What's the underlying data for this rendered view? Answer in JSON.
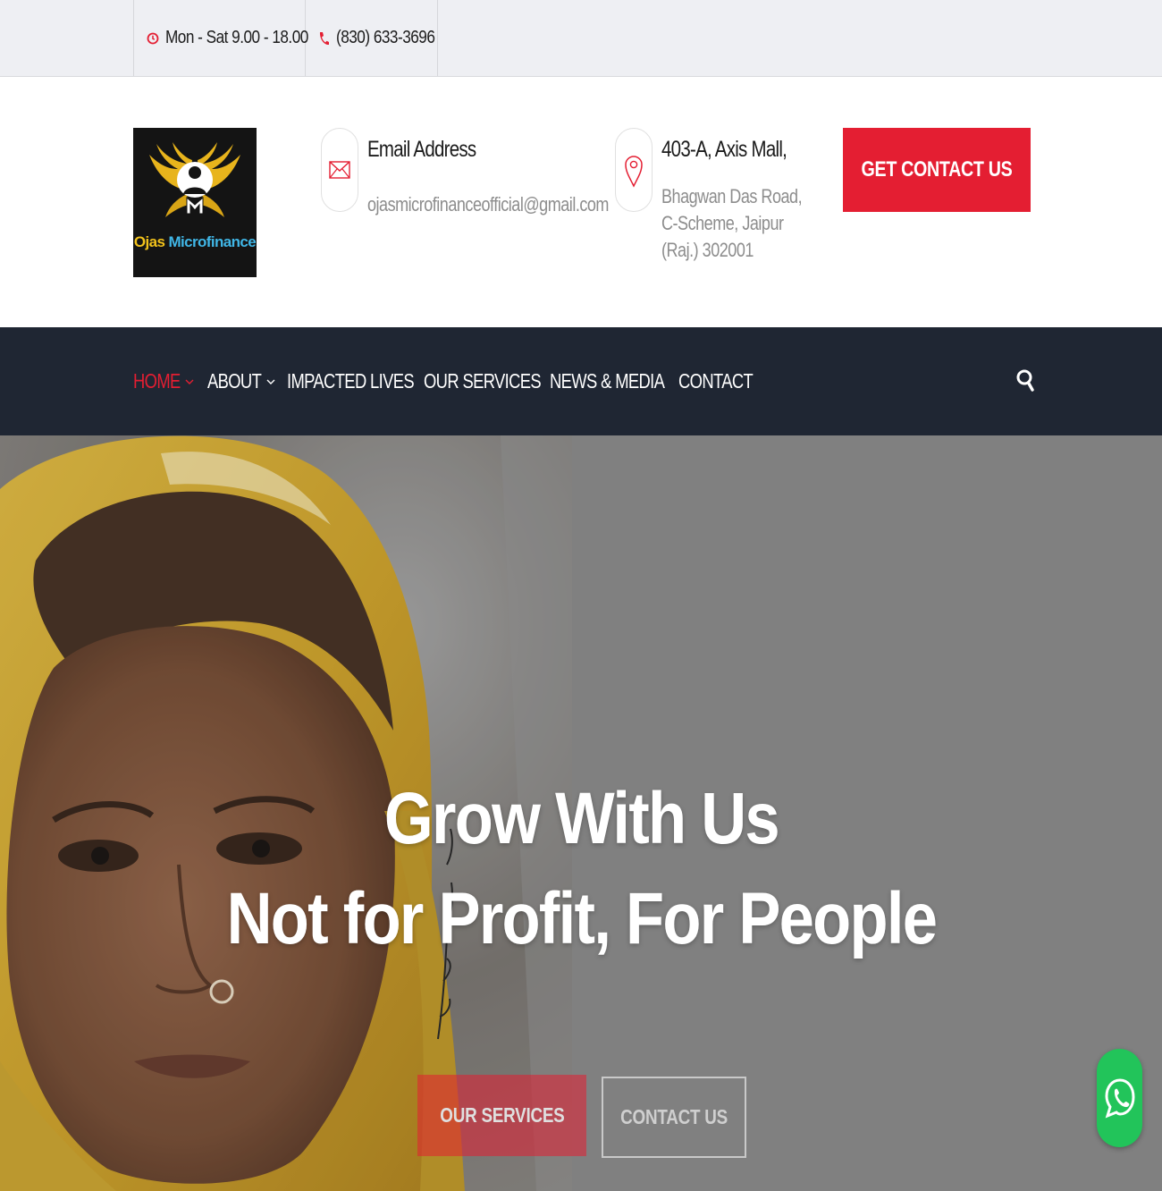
{
  "topbar": {
    "hours": "Mon - Sat 9.00 - 18.00",
    "phone": "(830) 633-3696"
  },
  "logo": {
    "word1": "Ojas",
    "word2": "Microfinance"
  },
  "email_block": {
    "title": "Email Address",
    "value": "ojasmicrofinanceofficial@gmail.com"
  },
  "address_block": {
    "title": "403-A, Axis Mall,",
    "line1": "Bhagwan Das Road,",
    "line2": "C-Scheme, Jaipur",
    "line3": "(Raj.) 302001"
  },
  "header_cta": "GET CONTACT US",
  "nav": {
    "items": [
      {
        "label": "HOME",
        "dropdown": true
      },
      {
        "label": "ABOUT",
        "dropdown": true
      },
      {
        "label": "IMPACTED LIVES",
        "dropdown": true
      },
      {
        "label": "OUR SERVICES",
        "dropdown": true
      },
      {
        "label": "NEWS & MEDIA",
        "dropdown": true
      },
      {
        "label": "CONTACT",
        "dropdown": false
      }
    ]
  },
  "hero": {
    "line1": "Grow With Us",
    "line2": "Not for Profit, For People",
    "primary_button": "OUR SERVICES",
    "secondary_button": "CONTACT US"
  },
  "colors": {
    "accent": "#e41e32",
    "nav_bg": "#1f2633",
    "topbar_bg": "#eeeff3",
    "whatsapp": "#22c45a"
  },
  "icons": [
    "clock-icon",
    "phone-icon",
    "mail-icon",
    "location-pin-icon",
    "search-icon",
    "chevron-down-icon",
    "whatsapp-icon"
  ]
}
